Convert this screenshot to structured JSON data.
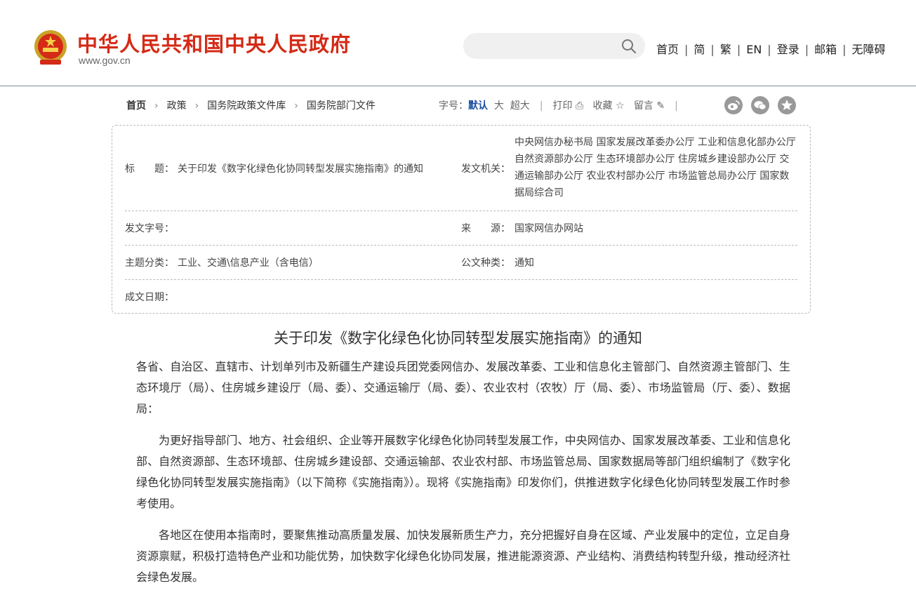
{
  "header": {
    "site_title": "中华人民共和国中央人民政府",
    "site_url": "www.gov.cn",
    "search": {
      "placeholder": ""
    },
    "nav": [
      "首页",
      "简",
      "繁",
      "EN",
      "登录",
      "邮箱",
      "无障碍"
    ]
  },
  "breadcrumb": {
    "items": [
      "首页",
      "政策",
      "国务院政策文件库",
      "国务院部门文件"
    ]
  },
  "tools": {
    "font_label": "字号：",
    "font_default": "默认",
    "font_large": "大",
    "font_xlarge": "超大",
    "print": "打印",
    "favorite": "收藏",
    "comment": "留言"
  },
  "meta": {
    "title_label": "标　　题：",
    "title_value": "关于印发《数字化绿色化协同转型发展实施指南》的通知",
    "issuer_label": "发文机关：",
    "issuer_value": "中央网信办秘书局 国家发展改革委办公厅 工业和信息化部办公厅 自然资源部办公厅 生态环境部办公厅 住房城乡建设部办公厅 交通运输部办公厅 农业农村部办公厅 市场监管总局办公厅 国家数据局综合司",
    "docno_label": "发文字号：",
    "docno_value": "",
    "source_label": "来　　源：",
    "source_value": "国家网信办网站",
    "topic_label": "主题分类：",
    "topic_value": "工业、交通\\信息产业（含电信）",
    "doctype_label": "公文种类：",
    "doctype_value": "通知",
    "date_label": "成文日期：",
    "date_value": ""
  },
  "article": {
    "title": "关于印发《数字化绿色化协同转型发展实施指南》的通知",
    "paragraphs": [
      "各省、自治区、直辖市、计划单列市及新疆生产建设兵团党委网信办、发展改革委、工业和信息化主管部门、自然资源主管部门、生态环境厅（局）、住房城乡建设厅（局、委）、交通运输厅（局、委）、农业农村（农牧）厅（局、委）、市场监管局（厅、委）、数据局：",
      "为更好指导部门、地方、社会组织、企业等开展数字化绿色化协同转型发展工作，中央网信办、国家发展改革委、工业和信息化部、自然资源部、生态环境部、住房城乡建设部、交通运输部、农业农村部、市场监管总局、国家数据局等部门组织编制了《数字化绿色化协同转型发展实施指南》（以下简称《实施指南》）。现将《实施指南》印发你们，供推进数字化绿色化协同转型发展工作时参考使用。",
      "各地区在使用本指南时，要聚焦推动高质量发展、加快发展新质生产力，充分把握好自身在区域、产业发展中的定位，立足自身资源禀赋，积极打造特色产业和功能优势，加快数字化绿色化协同发展，推进能源资源、产业结构、消费结构转型升级，推动经济社会绿色发展。"
    ]
  }
}
